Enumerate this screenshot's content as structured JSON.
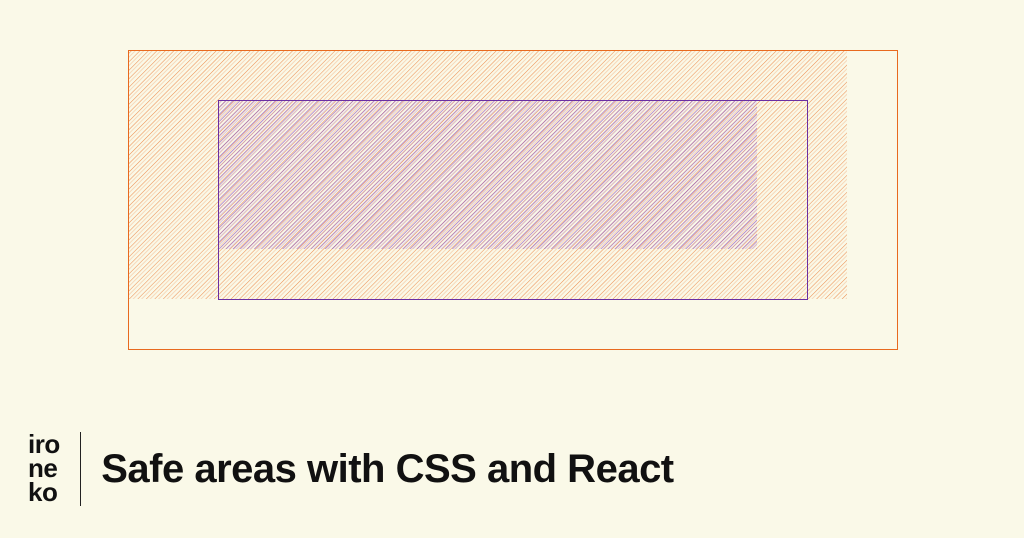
{
  "logo": {
    "line1": "iro",
    "line2": "ne",
    "line3": "ko"
  },
  "title": "Safe areas with CSS and React",
  "colors": {
    "outer": "#e86a1f",
    "inner": "#8a4fc4",
    "innerBorder": "#6b2fa3",
    "background": "#faf9e8"
  },
  "illustration": {
    "description": "sketchy hatched nested rectangles representing safe area insets"
  }
}
